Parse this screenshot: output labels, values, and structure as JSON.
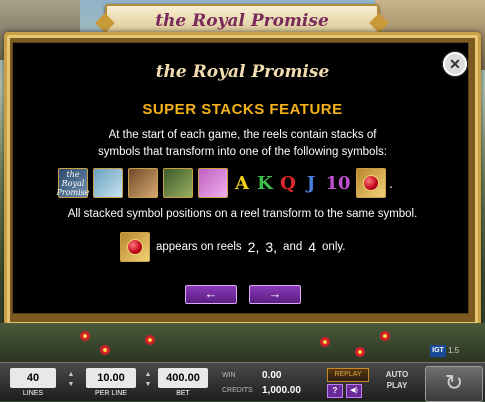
{
  "game": {
    "logo": "the Royal Promise"
  },
  "paytable": {
    "logo": "the Royal Promise",
    "feature_title": "SUPER STACKS FEATURE",
    "description_line1": "At the start of each game, the reels contain stacks of",
    "description_line2": "symbols that transform into one of the following symbols:",
    "symbols": [
      {
        "name": "logo-symbol",
        "text": "the Royal Promise"
      },
      {
        "name": "fairy-symbol",
        "text": ""
      },
      {
        "name": "prince-symbol",
        "text": ""
      },
      {
        "name": "dragon-symbol",
        "text": ""
      },
      {
        "name": "ring-symbol",
        "text": ""
      }
    ],
    "letters": [
      "A",
      "K",
      "Q",
      "J",
      "10"
    ],
    "period": ".",
    "stack_text": "All stacked symbol positions on a reel transform to the same symbol.",
    "reels_text_a": "appears on reels",
    "reel_a": "2,",
    "reel_b": "3,",
    "reels_and": "and",
    "reel_c": "4",
    "reels_text_b": "only.",
    "prev_arrow": "←",
    "next_arrow": "→",
    "close": "✕"
  },
  "badge": {
    "igt": "IGT",
    "side": "1.5"
  },
  "controls": {
    "lines_value": "40",
    "lines_label": "LINES",
    "per_line_value": "10.00",
    "per_line_label": "PER LINE",
    "bet_value": "400.00",
    "bet_label": "BET",
    "win_label": "WIN",
    "win_value": "0.00",
    "credits_label": "CREDITS",
    "credits_value": "1,000.00",
    "replay_label": "REPLAY",
    "help_label": "?",
    "sound_label": "◀)",
    "autoplay_line1": "AUTO",
    "autoplay_line2": "PLAY",
    "spin_icon": "↻"
  },
  "colors": {
    "accent_gold": "#c9a048",
    "feature_orange": "#f5b21a",
    "nav_purple": "#8b3ab8"
  }
}
